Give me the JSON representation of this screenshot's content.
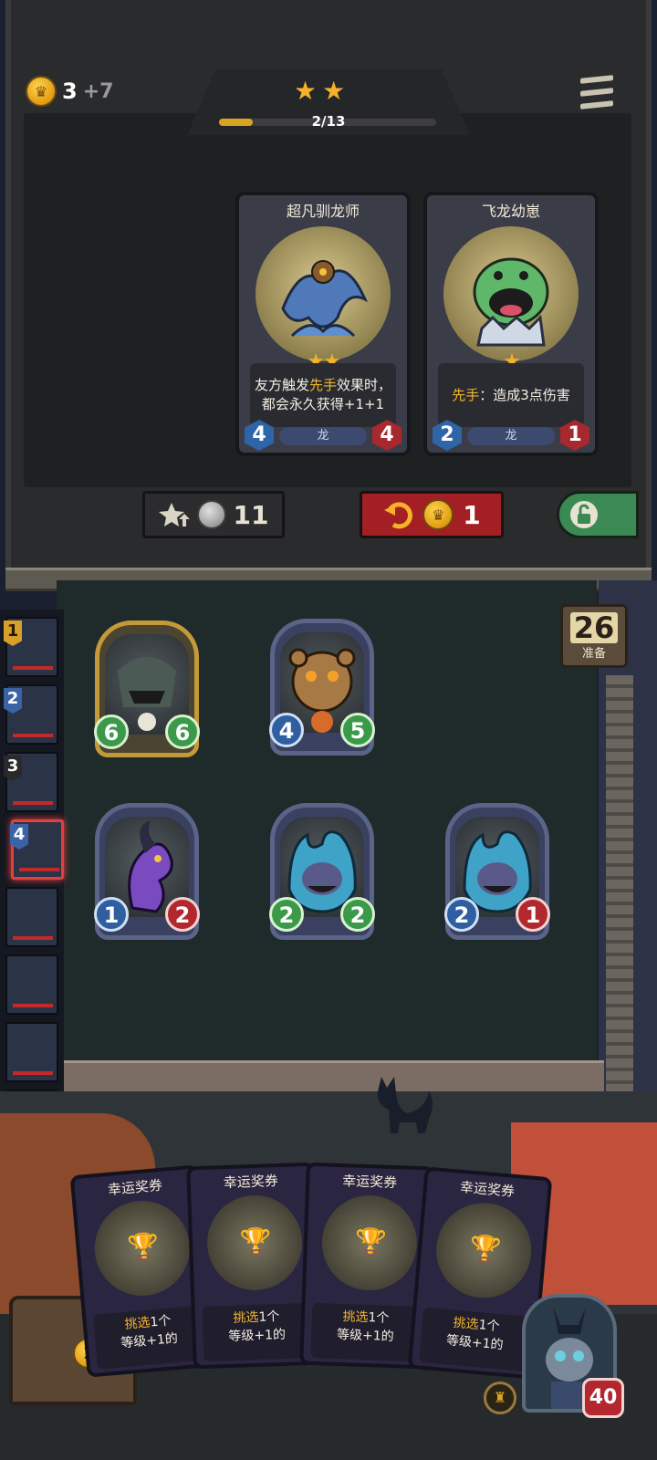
{
  "gold": {
    "current": "3",
    "income": "+7",
    "icon": "crown-coin-icon"
  },
  "tavern": {
    "tier_stars": "★★",
    "progress_text": "2/13",
    "progress_fraction": 0.154
  },
  "shop_cards": [
    {
      "name": "超凡驯龙师",
      "stars": "★★",
      "desc_pre": "友方触发",
      "desc_kw": "先手",
      "desc_post": "效果时，都会永久获得+1+1",
      "tribe": "龙",
      "attack": "4",
      "health": "4"
    },
    {
      "name": "飞龙幼崽",
      "stars": "★",
      "desc_pre": "",
      "desc_kw": "先手",
      "desc_post": "：造成3点伤害",
      "tribe": "龙",
      "attack": "2",
      "health": "1"
    }
  ],
  "buttons": {
    "upgrade_cost": "11",
    "refresh_cost": "1"
  },
  "prep": {
    "count": "26",
    "label": "准备"
  },
  "board": {
    "row1": [
      {
        "name": "skull-demon-minion",
        "attack": "6",
        "health": "6",
        "golden": true
      },
      {
        "name": "bear-minion",
        "attack": "4",
        "health": "5",
        "golden": false
      }
    ],
    "row2": [
      {
        "name": "purple-dragon-minion",
        "attack": "1",
        "health": "2",
        "golden": false
      },
      {
        "name": "blue-flame-minion",
        "attack": "2",
        "health": "2",
        "golden": false
      },
      {
        "name": "blue-flame-minion",
        "attack": "2",
        "health": "1",
        "golden": false
      }
    ]
  },
  "opponents": [
    {
      "rank": "1"
    },
    {
      "rank": "2"
    },
    {
      "rank": "3"
    },
    {
      "rank": "4"
    }
  ],
  "hand": [
    {
      "name": "幸运奖券",
      "desc_kw": "挑选",
      "desc_rest": "1个",
      "desc_line2": "等级+1的"
    },
    {
      "name": "幸运奖券",
      "desc_kw": "挑选",
      "desc_rest": "1个",
      "desc_line2": "等级+1的"
    },
    {
      "name": "幸运奖券",
      "desc_kw": "挑选",
      "desc_rest": "1个",
      "desc_line2": "等级+1的"
    },
    {
      "name": "幸运奖券",
      "desc_kw": "挑选",
      "desc_rest": "1个",
      "desc_line2": "等级+1的"
    }
  ],
  "hero": {
    "health": "40"
  },
  "crate": {
    "coin": "1"
  }
}
